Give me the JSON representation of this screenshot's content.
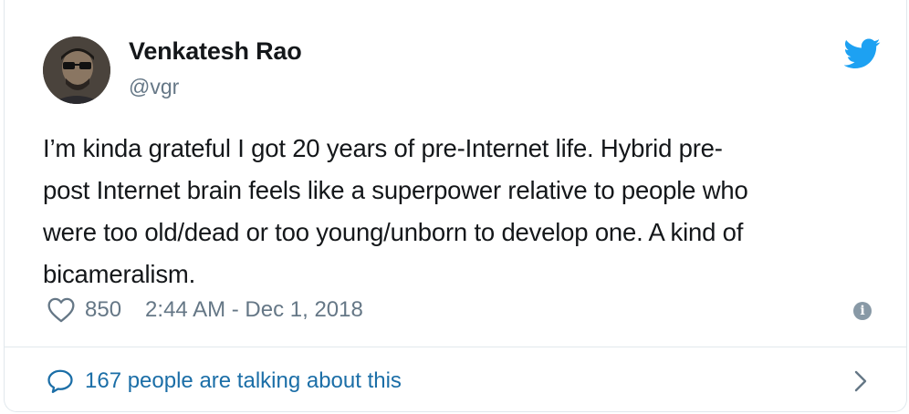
{
  "author": {
    "name": "Venkatesh Rao",
    "handle": "@vgr",
    "avatar_icon": "avatar-photo"
  },
  "brand": {
    "icon": "twitter-bird-icon",
    "color": "#1da1f2"
  },
  "tweet": {
    "text": "I’m kinda grateful I got 20 years of pre-Internet life. Hybrid pre-post Internet brain feels like a superpower relative to people who were too old/dead or too young/unborn to develop one. A kind of bicameralism.",
    "lines": [
      "I’m kinda grateful I got 20 years of pre-Internet life. Hybrid pre-",
      "post Internet brain feels like a superpower relative to people who",
      "were too old/dead or too young/unborn to develop one. A kind of",
      "bicameralism."
    ]
  },
  "meta": {
    "like_icon": "heart-icon",
    "likes": "850",
    "timestamp": "2:44 AM - Dec 1, 2018",
    "info_icon": "info-icon",
    "info_glyph": "i"
  },
  "footer": {
    "bubble_icon": "speech-bubble-icon",
    "talking_text": "167 people are talking about this",
    "chevron_icon": "chevron-right-icon",
    "link_color": "#1b6ea7"
  }
}
